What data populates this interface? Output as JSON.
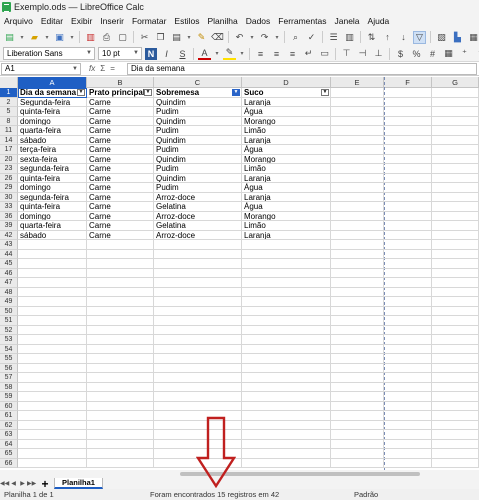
{
  "window": {
    "title": "Exemplo.ods — LibreOffice Calc"
  },
  "menu": [
    "Arquivo",
    "Editar",
    "Exibir",
    "Inserir",
    "Formatar",
    "Estilos",
    "Planilha",
    "Dados",
    "Ferramentas",
    "Janela",
    "Ajuda"
  ],
  "toolbar": {
    "font_name": "Liberation Sans",
    "font_size": "10 pt",
    "bold": "N",
    "italic": "I",
    "underline": "S",
    "font_color": "A"
  },
  "formula": {
    "name_box": "A1",
    "fx_label": "fx",
    "sum_label": "Σ",
    "equals_label": "=",
    "content": "Dia da semana"
  },
  "columns": [
    "A",
    "B",
    "C",
    "D",
    "E",
    "F",
    "G"
  ],
  "table": {
    "headers": [
      "Dia da semana",
      "Prato principal",
      "Sobremesa",
      "Suco"
    ],
    "rows": [
      {
        "row": "2",
        "cells": [
          "Segunda-feira",
          "Carne",
          "Quindim",
          "Laranja"
        ]
      },
      {
        "row": "5",
        "cells": [
          "quinta-feira",
          "Carne",
          "Pudim",
          "Água"
        ]
      },
      {
        "row": "8",
        "cells": [
          "domingo",
          "Carne",
          "Quindim",
          "Morango"
        ]
      },
      {
        "row": "11",
        "cells": [
          "quarta-feira",
          "Carne",
          "Pudim",
          "Limão"
        ]
      },
      {
        "row": "14",
        "cells": [
          "sábado",
          "Carne",
          "Quindim",
          "Laranja"
        ]
      },
      {
        "row": "17",
        "cells": [
          "terça-feira",
          "Carne",
          "Pudim",
          "Água"
        ]
      },
      {
        "row": "20",
        "cells": [
          "sexta-feira",
          "Carne",
          "Quindim",
          "Morango"
        ]
      },
      {
        "row": "23",
        "cells": [
          "segunda-feira",
          "Carne",
          "Pudim",
          "Limão"
        ]
      },
      {
        "row": "26",
        "cells": [
          "quinta-feira",
          "Carne",
          "Quindim",
          "Laranja"
        ]
      },
      {
        "row": "29",
        "cells": [
          "domingo",
          "Carne",
          "Pudim",
          "Água"
        ]
      },
      {
        "row": "30",
        "cells": [
          "segunda-feira",
          "Carne",
          "Arroz-doce",
          "Laranja"
        ]
      },
      {
        "row": "33",
        "cells": [
          "quinta-feira",
          "Carne",
          "Gelatina",
          "Água"
        ]
      },
      {
        "row": "36",
        "cells": [
          "domingo",
          "Carne",
          "Arroz-doce",
          "Morango"
        ]
      },
      {
        "row": "39",
        "cells": [
          "quarta-feira",
          "Carne",
          "Gelatina",
          "Limão"
        ]
      },
      {
        "row": "42",
        "cells": [
          "sábado",
          "Carne",
          "Arroz-doce",
          "Laranja"
        ]
      }
    ],
    "empty_rows": [
      "43",
      "44",
      "45",
      "46",
      "47",
      "48",
      "49",
      "50",
      "51",
      "52",
      "53",
      "54",
      "55",
      "56",
      "57",
      "58",
      "59",
      "60",
      "61",
      "62",
      "63",
      "64",
      "65",
      "66"
    ]
  },
  "sheet_tabs": {
    "active": "Planilha1",
    "add": "+"
  },
  "status": {
    "sheet": "Planilha 1 de 1",
    "message": "Foram encontrados 15 registros em 42",
    "page_style": "Padrão"
  },
  "colors": {
    "selection": "#1f5fc4",
    "arrow": "#c0201f"
  }
}
